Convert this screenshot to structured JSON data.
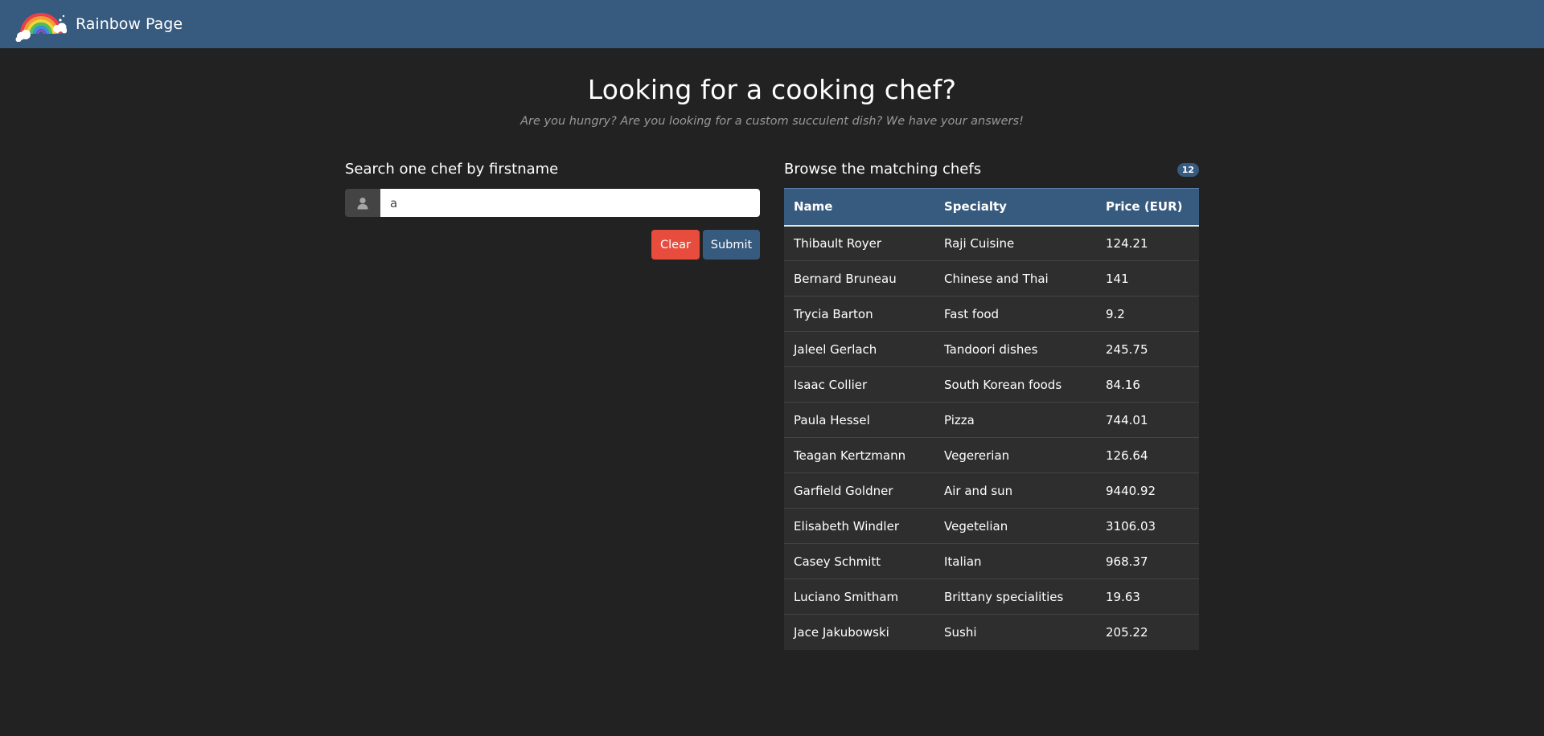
{
  "navbar": {
    "brand_text": "Rainbow Page",
    "logo_icon": "rainbow-logo-icon",
    "background": "#375a7f"
  },
  "hero": {
    "title": "Looking for a cooking chef?",
    "subtitle": "Are you hungry? Are you looking for a custom succulent dish? We have your answers!"
  },
  "search": {
    "heading": "Search one chef by firstname",
    "input_value": "a",
    "addon_icon": "user-icon",
    "clear_label": "Clear",
    "submit_label": "Submit",
    "clear_color": "#e74c3c",
    "submit_color": "#375a7f"
  },
  "results": {
    "heading": "Browse the matching chefs",
    "count": "12",
    "columns": [
      "Name",
      "Specialty",
      "Price (EUR)"
    ],
    "rows": [
      [
        "Thibault Royer",
        "Raji Cuisine",
        "124.21"
      ],
      [
        "Bernard Bruneau",
        "Chinese and Thai",
        "141"
      ],
      [
        "Trycia Barton",
        "Fast food",
        "9.2"
      ],
      [
        "Jaleel Gerlach",
        "Tandoori dishes",
        "245.75"
      ],
      [
        "Isaac Collier",
        "South Korean foods",
        "84.16"
      ],
      [
        "Paula Hessel",
        "Pizza",
        "744.01"
      ],
      [
        "Teagan Kertzmann",
        "Vegererian",
        "126.64"
      ],
      [
        "Garfield Goldner",
        "Air and sun",
        "9440.92"
      ],
      [
        "Elisabeth Windler",
        "Vegetelian",
        "3106.03"
      ],
      [
        "Casey Schmitt",
        "Italian",
        "968.37"
      ],
      [
        "Luciano Smitham",
        "Brittany specialities",
        "19.63"
      ],
      [
        "Jace Jakubowski",
        "Sushi",
        "205.22"
      ]
    ]
  }
}
